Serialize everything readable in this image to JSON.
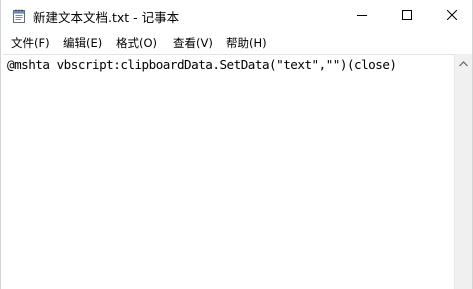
{
  "window": {
    "title": "新建文本文档.txt - 记事本"
  },
  "menu": {
    "file": "文件(F)",
    "edit": "编辑(E)",
    "format": "格式(O)",
    "view": "查看(V)",
    "help": "帮助(H)"
  },
  "editor": {
    "content": "@mshta vbscript:clipboardData.SetData(\"text\",\"\")(close)"
  },
  "icons": {
    "app": "notepad-icon",
    "minimize": "minimize-icon",
    "maximize": "maximize-icon",
    "close": "close-icon",
    "scroll_up": "scroll-up-arrow-icon"
  }
}
